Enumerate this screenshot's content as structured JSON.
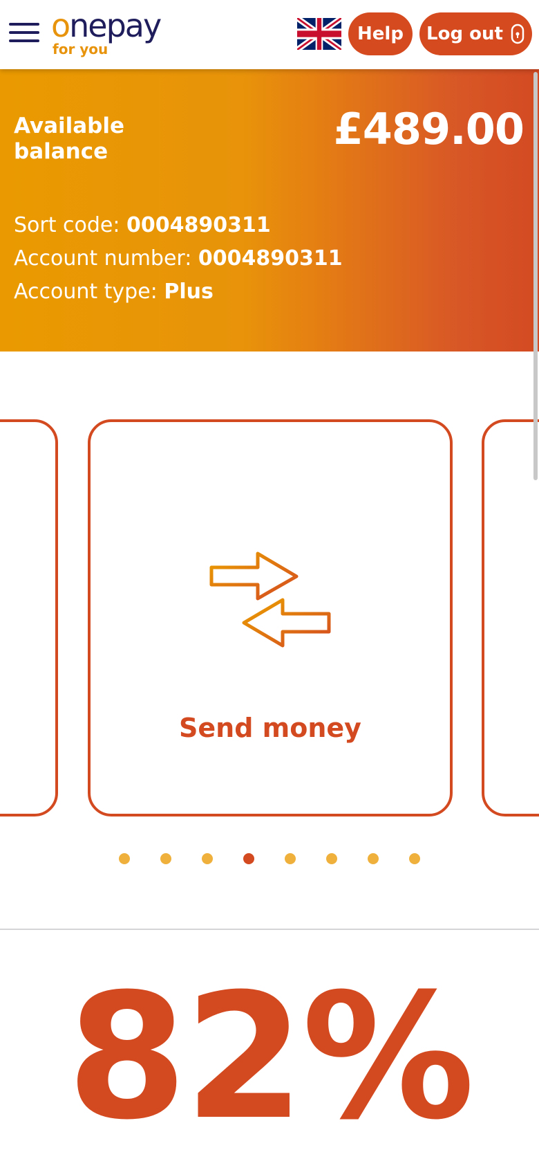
{
  "header": {
    "logo_main_o": "o",
    "logo_main_rest": "nepay",
    "logo_sub": "for you",
    "help_label": "Help",
    "logout_label": "Log out",
    "icons": [
      "menu-icon",
      "uk-flag-icon",
      "lock-icon"
    ]
  },
  "balance": {
    "label": "Available balance",
    "amount": "£489.00",
    "sort_code_label": "Sort code:",
    "sort_code": "0004890311",
    "account_number_label": "Account number:",
    "account_number": "0004890311",
    "account_type_label": "Account type:",
    "account_type": "Plus"
  },
  "carousel": {
    "active_card_label": "Send money",
    "active_card_icon": "send-money-arrows-icon",
    "dot_count": 8,
    "active_dot_index": 3
  },
  "stat": {
    "value": "82%"
  },
  "colors": {
    "brand_navy": "#1f1d5c",
    "brand_orange": "#e8930c",
    "accent_red": "#d44a20",
    "dot_inactive": "#efb13c"
  }
}
